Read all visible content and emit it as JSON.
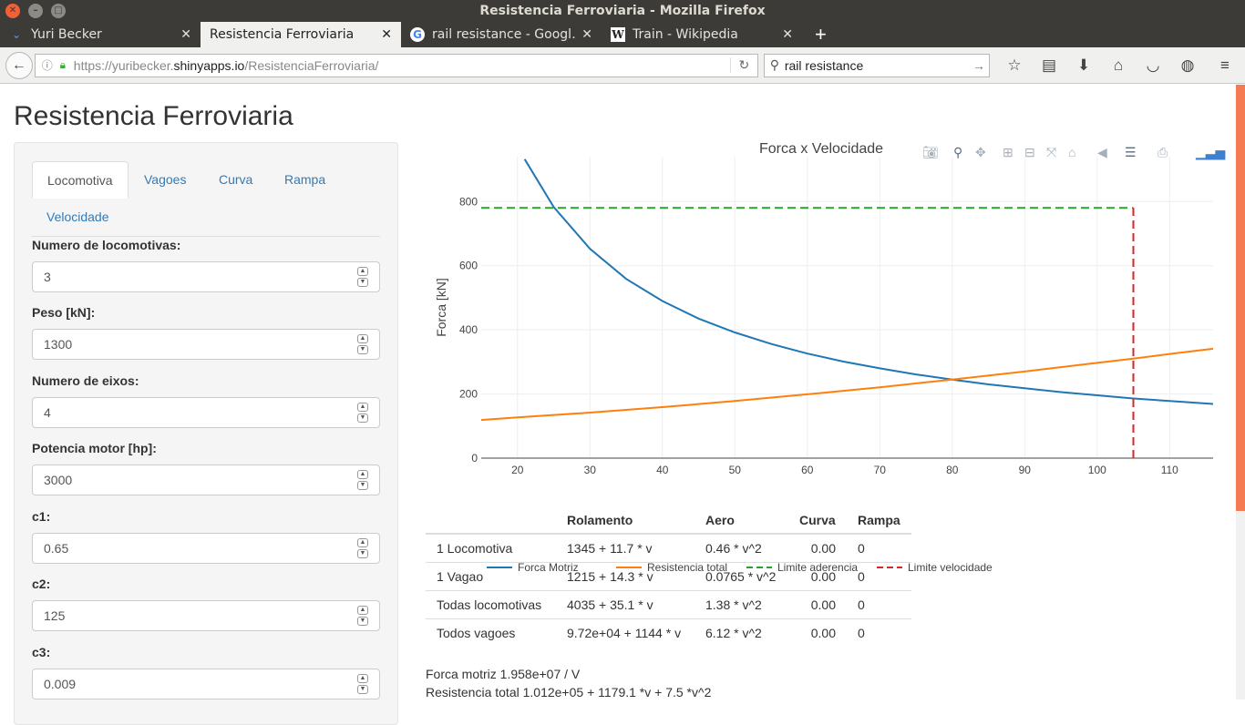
{
  "window": {
    "title": "Resistencia Ferroviaria - Mozilla Firefox"
  },
  "tabs": [
    {
      "label": "Yuri Becker",
      "favicon": "chevron-down-icon",
      "active": false
    },
    {
      "label": "Resistencia Ferroviaria",
      "favicon": "",
      "active": true
    },
    {
      "label": "rail resistance - Googl…",
      "favicon": "google-icon",
      "active": false
    },
    {
      "label": "Train - Wikipedia",
      "favicon": "wikipedia-icon",
      "active": false
    }
  ],
  "navbar": {
    "url_prefix": "https://yuribecker.",
    "url_host": "shinyapps.io",
    "url_path": "/ResistenciaFerroviaria/",
    "search_value": "rail resistance"
  },
  "page": {
    "title": "Resistencia Ferroviaria",
    "tabs": [
      "Locomotiva",
      "Vagoes",
      "Curva",
      "Rampa",
      "Velocidade"
    ],
    "fields": [
      {
        "label": "Numero de locomotivas:",
        "value": "3"
      },
      {
        "label": "Peso [kN]:",
        "value": "1300"
      },
      {
        "label": "Numero de eixos:",
        "value": "4"
      },
      {
        "label": "Potencia motor [hp]:",
        "value": "3000"
      },
      {
        "label": "c1:",
        "value": "0.65"
      },
      {
        "label": "c2:",
        "value": "125"
      },
      {
        "label": "c3:",
        "value": "0.009"
      }
    ]
  },
  "chart_data": {
    "type": "line",
    "title": "Forca x Velocidade",
    "xlabel": "",
    "ylabel": "Forca [kN]",
    "xlim": [
      15,
      116
    ],
    "ylim": [
      0,
      940
    ],
    "xticks": [
      20,
      30,
      40,
      50,
      60,
      70,
      80,
      90,
      100,
      110
    ],
    "yticks": [
      0,
      200,
      400,
      600,
      800
    ],
    "grid": true,
    "legend_position": "bottom",
    "series": [
      {
        "name": "Forca Motriz",
        "color": "#1f77b4",
        "dash": "solid",
        "x": [
          21,
          25,
          30,
          35,
          40,
          45,
          50,
          55,
          60,
          65,
          70,
          75,
          80,
          85,
          90,
          95,
          100,
          105,
          110,
          116
        ],
        "y": [
          932,
          783,
          653,
          559,
          490,
          435,
          392,
          356,
          326,
          301,
          280,
          261,
          245,
          230,
          218,
          206,
          196,
          186,
          178,
          169
        ]
      },
      {
        "name": "Resistencia total",
        "color": "#ff7f0e",
        "dash": "solid",
        "x": [
          15,
          20,
          30,
          40,
          50,
          60,
          70,
          80,
          90,
          100,
          105,
          110,
          116
        ],
        "y": [
          119,
          127,
          142,
          159,
          178,
          199,
          221,
          245,
          270,
          297,
          310,
          325,
          341
        ]
      },
      {
        "name": "Limite aderencia",
        "color": "#2ca02c",
        "dash": "dash",
        "x": [
          15,
          105
        ],
        "y": [
          780,
          780
        ]
      },
      {
        "name": "Limite velocidade",
        "color": "#d62728",
        "dash": "dash",
        "x": [
          105,
          105
        ],
        "y": [
          0,
          780
        ]
      }
    ]
  },
  "table": {
    "headers": [
      "",
      "Rolamento",
      "Aero",
      "Curva",
      "Rampa"
    ],
    "rows": [
      [
        "1 Locomotiva",
        "1345 + 11.7 * v",
        "0.46 * v^2",
        "0.00",
        "0"
      ],
      [
        "1 Vagao",
        "1215 + 14.3 * v",
        "0.0765 * v^2",
        "0.00",
        "0"
      ],
      [
        "Todas locomotivas",
        "4035 + 35.1 * v",
        "1.38 * v^2",
        "0.00",
        "0"
      ],
      [
        "Todos vagoes",
        "9.72e+04 + 1144 * v",
        "6.12 * v^2",
        "0.00",
        "0"
      ]
    ]
  },
  "output": {
    "forca_motriz": "Forca motriz 1.958e+07 / V",
    "resistencia_total": "Resistencia total 1.012e+05 + 1179.1 *v + 7.5 *v^2"
  }
}
